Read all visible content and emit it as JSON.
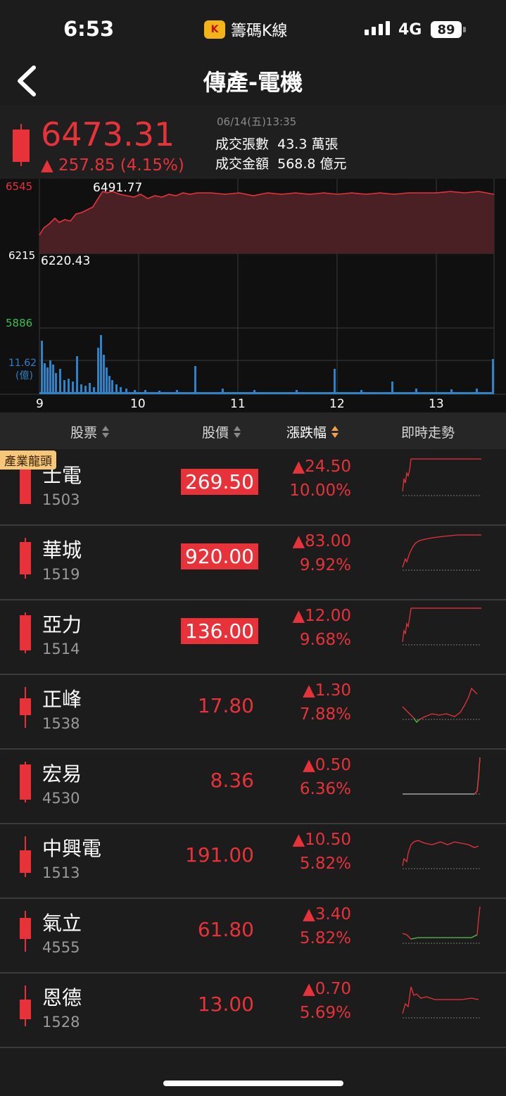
{
  "status": {
    "time": "6:53",
    "app": "籌碼K線",
    "network": "4G",
    "battery": "89"
  },
  "header": {
    "title": "傳產-電機"
  },
  "summary": {
    "price": "6473.31",
    "change": "▲ 257.85 (4.15%)",
    "datetime": "06/14(五)13:35",
    "volume_label": "成交張數",
    "volume": "43.3 萬張",
    "amount_label": "成交金額",
    "amount": "568.8 億元"
  },
  "chart": {
    "y_high": "6545",
    "y_mid": "6215",
    "y_low": "5886",
    "max_label": "6491.77",
    "min_label": "6220.43",
    "vol_label": "11.62",
    "vol_unit": "(億)",
    "x_ticks": [
      "9",
      "10",
      "11",
      "12",
      "13"
    ]
  },
  "table": {
    "col_stock": "股票",
    "col_price": "股價",
    "col_change": "漲跌幅",
    "col_trend": "即時走勢",
    "tag": "產業龍頭",
    "rows": [
      {
        "name": "士電",
        "code": "1503",
        "price": "269.50",
        "change": "▲24.50",
        "pct": "10.00%",
        "limit": true
      },
      {
        "name": "華城",
        "code": "1519",
        "price": "920.00",
        "change": "▲83.00",
        "pct": "9.92%",
        "limit": true
      },
      {
        "name": "亞力",
        "code": "1514",
        "price": "136.00",
        "change": "▲12.00",
        "pct": "9.68%",
        "limit": true
      },
      {
        "name": "正峰",
        "code": "1538",
        "price": "17.80",
        "change": "▲1.30",
        "pct": "7.88%",
        "limit": false
      },
      {
        "name": "宏易",
        "code": "4530",
        "price": "8.36",
        "change": "▲0.50",
        "pct": "6.36%",
        "limit": false
      },
      {
        "name": "中興電",
        "code": "1513",
        "price": "191.00",
        "change": "▲10.50",
        "pct": "5.82%",
        "limit": false
      },
      {
        "name": "氣立",
        "code": "4555",
        "price": "61.80",
        "change": "▲3.40",
        "pct": "5.82%",
        "limit": false
      },
      {
        "name": "恩德",
        "code": "1528",
        "price": "13.00",
        "change": "▲0.70",
        "pct": "5.69%",
        "limit": false
      }
    ]
  },
  "colors": {
    "up": "#e8323a",
    "down": "#3fbf4f",
    "accent": "#f5a04a"
  }
}
